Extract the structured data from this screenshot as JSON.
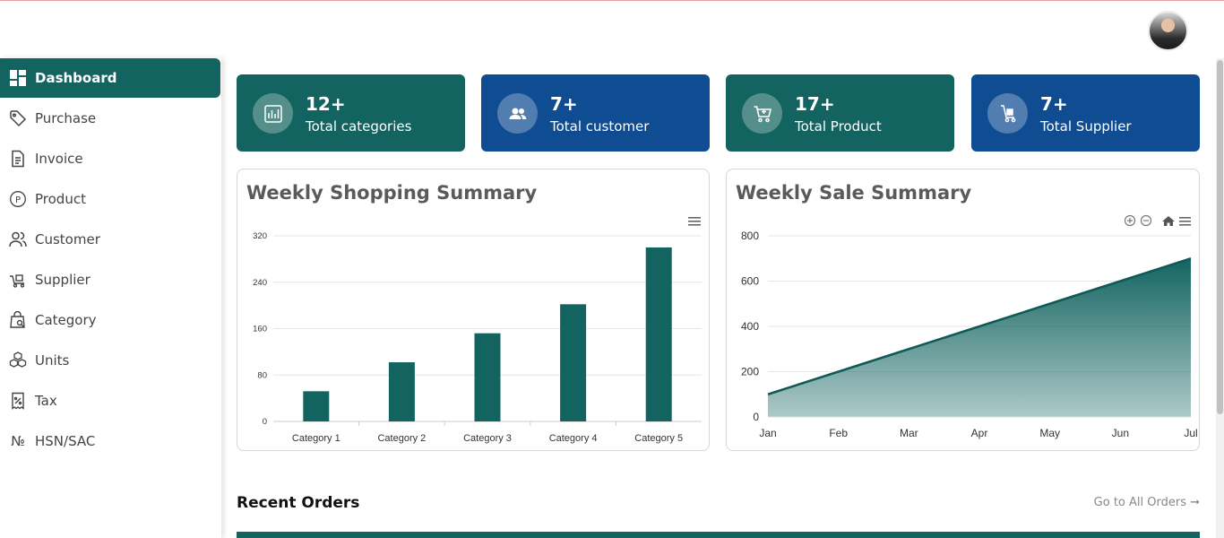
{
  "sidebar": {
    "items": [
      {
        "label": "Dashboard",
        "icon": "dashboard-icon",
        "active": true
      },
      {
        "label": "Purchase",
        "icon": "tag-icon"
      },
      {
        "label": "Invoice",
        "icon": "invoice-icon"
      },
      {
        "label": "Product",
        "icon": "product-icon"
      },
      {
        "label": "Customer",
        "icon": "customer-icon"
      },
      {
        "label": "Supplier",
        "icon": "supplier-icon"
      },
      {
        "label": "Category",
        "icon": "category-icon"
      },
      {
        "label": "Units",
        "icon": "units-icon"
      },
      {
        "label": "Tax",
        "icon": "tax-icon"
      },
      {
        "label": "HSN/SAC",
        "icon": "hsn-icon",
        "glyph": "№"
      }
    ]
  },
  "stats": [
    {
      "value": "12+",
      "label": "Total categories",
      "icon": "chart-icon",
      "color": "#136460"
    },
    {
      "value": "7+",
      "label": "Total customer",
      "icon": "users-icon",
      "color": "#0f4c92"
    },
    {
      "value": "17+",
      "label": "Total Product",
      "icon": "cart-icon",
      "color": "#136460"
    },
    {
      "value": "7+",
      "label": "Total Supplier",
      "icon": "trolley-icon",
      "color": "#0f4c92"
    }
  ],
  "charts": {
    "shopping_title": "Weekly Shopping Summary",
    "sale_title": "Weekly Sale Summary"
  },
  "chart_data": [
    {
      "type": "bar",
      "title": "Weekly Shopping Summary",
      "categories": [
        "Category 1",
        "Category 2",
        "Category 3",
        "Category 4",
        "Category 5"
      ],
      "values": [
        52,
        102,
        152,
        202,
        300
      ],
      "yticks": [
        0,
        80,
        160,
        240,
        320
      ],
      "ylim": [
        0,
        320
      ],
      "color": "#136460",
      "grid": true
    },
    {
      "type": "area",
      "title": "Weekly Sale Summary",
      "x": [
        "Jan",
        "Feb",
        "Mar",
        "Apr",
        "May",
        "Jun",
        "Jul"
      ],
      "values": [
        100,
        200,
        300,
        400,
        500,
        600,
        700
      ],
      "yticks": [
        0,
        200,
        400,
        600,
        800
      ],
      "ylim": [
        0,
        800
      ],
      "color": "#136460",
      "grid": true
    }
  ],
  "recent": {
    "title": "Recent Orders",
    "link": "Go to All Orders ➞"
  },
  "colors": {
    "teal": "#136460",
    "blue": "#0f4c92"
  }
}
